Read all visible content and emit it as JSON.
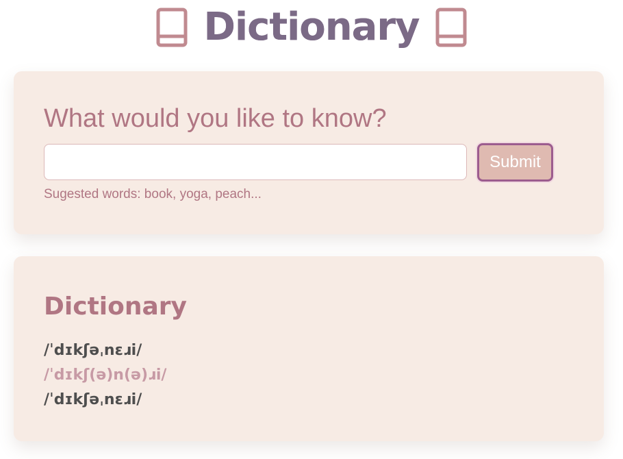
{
  "header": {
    "title": "Dictionary",
    "left_icon": "book-icon",
    "right_icon": "book-icon"
  },
  "search": {
    "question": "What would you like to know?",
    "input_value": "",
    "input_placeholder": "",
    "submit_label": "Submit",
    "suggestions": "Sugested words: book, yoga, peach..."
  },
  "result": {
    "word": "Dictionary",
    "phonetics": [
      "/ˈdɪkʃəˌnɛɹi/",
      "/ˈdɪkʃ(ə)n(ə)ɹi/",
      "/ˈdɪkʃəˌnɛɹi/"
    ]
  },
  "colors": {
    "accent": "#b07683",
    "title": "#7b6a86",
    "card_background": "#f7ebe4",
    "button_background": "#dfbab1",
    "button_border": "#9c5c8e"
  }
}
